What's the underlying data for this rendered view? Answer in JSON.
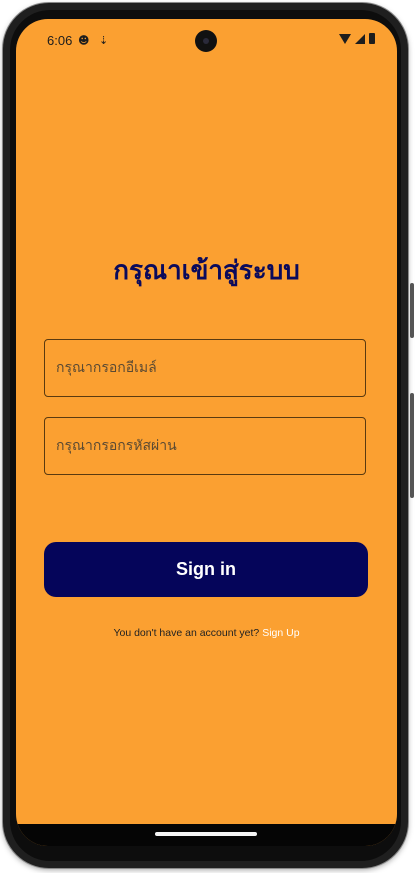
{
  "status_bar": {
    "time": "6:06",
    "left_icons": [
      "face-icon",
      "download-icon"
    ],
    "right_icons": [
      "wifi-icon",
      "signal-icon",
      "battery-icon"
    ]
  },
  "login": {
    "title": "กรุณาเข้าสู่ระบบ",
    "email_placeholder": "กรุณากรอกอีเมล์",
    "password_placeholder": "กรุณากรอกรหัสผ่าน",
    "signin_label": "Sign in",
    "no_account_text": "You don't have an account yet?",
    "signup_label": "Sign Up"
  },
  "colors": {
    "background": "#FBA031",
    "title": "#0A0A5C",
    "button": "#05055A",
    "button_text": "#FFFFFF",
    "link": "#FFFFFF"
  }
}
